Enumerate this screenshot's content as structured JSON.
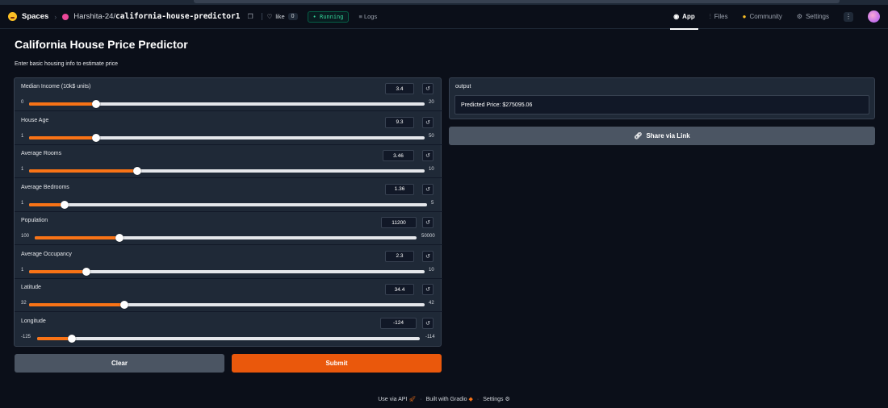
{
  "navbar": {
    "spaces_label": "Spaces",
    "owner": "Harshita-24/",
    "repo": "california-house-predictor1",
    "like_label": "like",
    "like_count": "0",
    "status": "• Running",
    "logs_label": "Logs",
    "tabs": [
      {
        "label": "App",
        "icon": "app-icon"
      },
      {
        "label": "Files",
        "icon": "files-icon"
      },
      {
        "label": "Community",
        "icon": "community-icon"
      },
      {
        "label": "Settings",
        "icon": "gear-icon"
      }
    ]
  },
  "page": {
    "title": "California House Price Predictor",
    "subtitle": "Enter basic housing info to estimate price"
  },
  "sliders": [
    {
      "label": "Median Income (10k$ units)",
      "value": "3.4",
      "min": "0",
      "max": "20",
      "fraction": 0.17
    },
    {
      "label": "House Age",
      "value": "9.3",
      "min": "1",
      "max": "50",
      "fraction": 0.17
    },
    {
      "label": "Average Rooms",
      "value": "3.46",
      "min": "1",
      "max": "10",
      "fraction": 0.273
    },
    {
      "label": "Average Bedrooms",
      "value": "1.36",
      "min": "1",
      "max": "5",
      "fraction": 0.09
    },
    {
      "label": "Population",
      "value": "11200",
      "min": "100",
      "max": "50000",
      "fraction": 0.222
    },
    {
      "label": "Average Occupancy",
      "value": "2.3",
      "min": "1",
      "max": "10",
      "fraction": 0.144
    },
    {
      "label": "Latitude",
      "value": "34.4",
      "min": "32",
      "max": "42",
      "fraction": 0.24
    },
    {
      "label": "Longitude",
      "value": "-124",
      "min": "-125",
      "max": "-114",
      "fraction": 0.091
    }
  ],
  "buttons": {
    "clear": "Clear",
    "submit": "Submit",
    "share": "Share via Link"
  },
  "output": {
    "label": "output",
    "value": "Predicted Price: $275095.06"
  },
  "footer": {
    "api": "Use via API",
    "built": "Built with Gradio",
    "settings": "Settings"
  },
  "colors": {
    "accent": "#f97316",
    "submit": "#ea580c",
    "panel": "#1f2937",
    "background": "#0b0f19"
  }
}
